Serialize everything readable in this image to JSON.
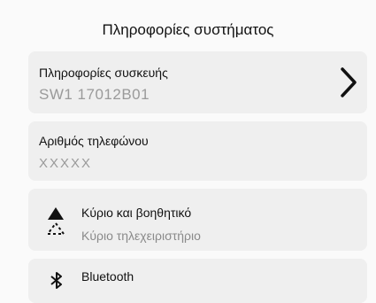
{
  "header": {
    "title": "Πληροφορίες συστήματος"
  },
  "device_info": {
    "label": "Πληροφορίες συσκευής",
    "value": "SW1 17012B01",
    "chevron_icon": "chevron-right-icon"
  },
  "phone": {
    "label": "Αριθμός τηλεφώνου",
    "value": "XXXXX"
  },
  "remote": {
    "label": "Κύριο και βοηθητικό",
    "subtitle": "Κύριο τηλεχειριστήριο",
    "icon": "remote-primary-secondary-icon"
  },
  "bluetooth": {
    "label": "Bluetooth",
    "icon": "bluetooth-icon"
  }
}
